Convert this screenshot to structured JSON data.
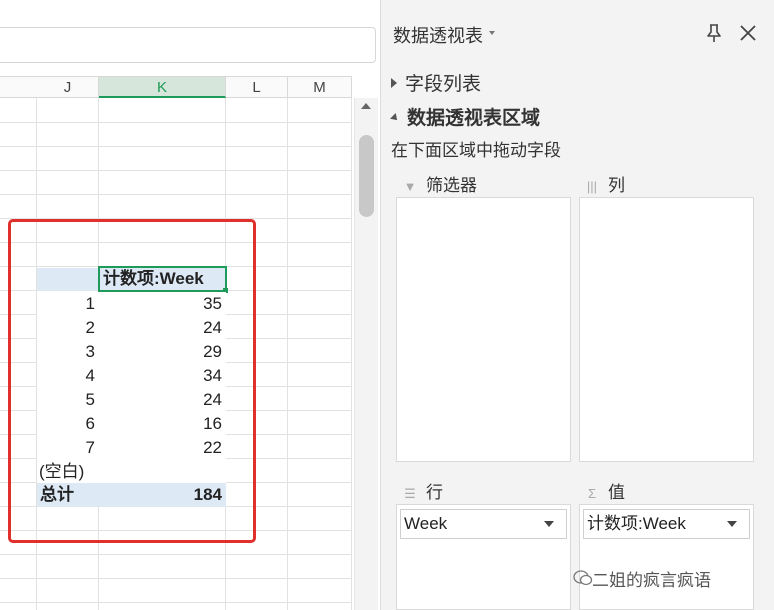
{
  "sheet": {
    "columns": [
      "J",
      "K",
      "L",
      "M"
    ],
    "selected_column": "K"
  },
  "pivot": {
    "header": "计数项:Week",
    "rows": [
      {
        "label": "1",
        "value": "35"
      },
      {
        "label": "2",
        "value": "24"
      },
      {
        "label": "3",
        "value": "29"
      },
      {
        "label": "4",
        "value": "34"
      },
      {
        "label": "5",
        "value": "24"
      },
      {
        "label": "6",
        "value": "16"
      },
      {
        "label": "7",
        "value": "22"
      },
      {
        "label": "(空白)",
        "value": ""
      }
    ],
    "total_label": "总计",
    "total_value": "184"
  },
  "panel": {
    "title": "数据透视表",
    "fields_list": "字段列表",
    "areas_heading": "数据透视表区域",
    "areas_hint": "在下面区域中拖动字段",
    "filters_label": "筛选器",
    "columns_label": "列",
    "rows_label": "行",
    "values_label": "值",
    "rows_field": "Week",
    "values_field": "计数项:Week"
  },
  "watermark": "二姐的疯言疯语",
  "colors": {
    "accent": "#1e9a5a",
    "highlight_box": "#e0302c",
    "pivot_header_bg": "#dde9f5"
  },
  "icons": {
    "pin": "pin-icon",
    "close": "close-icon",
    "filter": "filter-icon",
    "columns": "columns-icon",
    "rows": "rows-icon",
    "values": "sigma-icon"
  }
}
